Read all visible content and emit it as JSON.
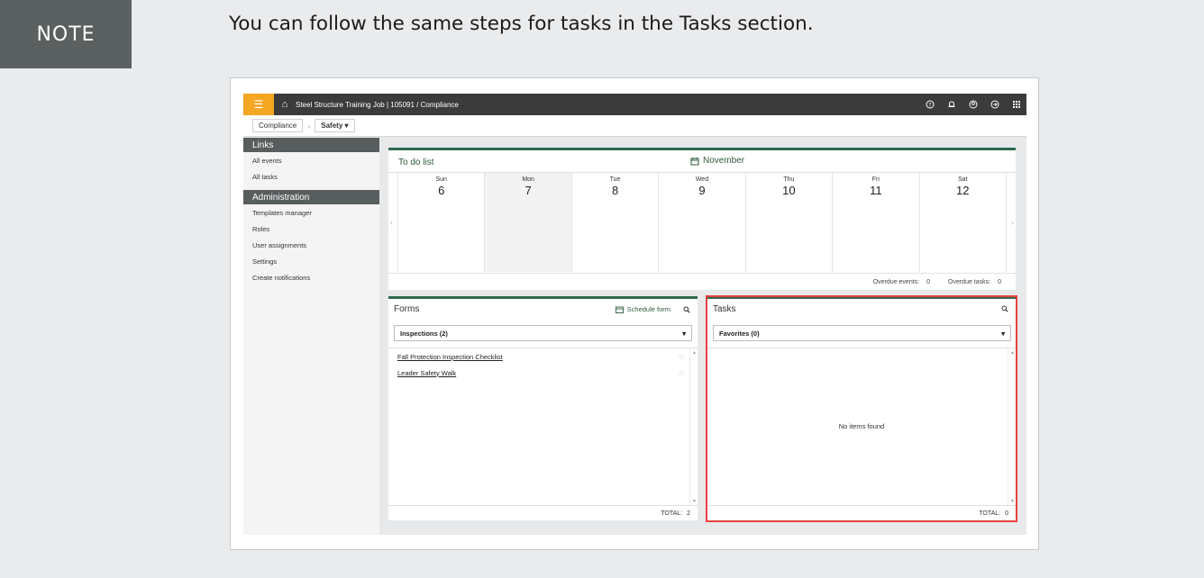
{
  "note": {
    "badge": "NOTE",
    "text": "You can follow the same steps for tasks in the Tasks section."
  },
  "topbar": {
    "menu_glyph": "☰",
    "home_glyph": "⌂",
    "title": "Steel Structure Training Job | 105091  /  Compliance",
    "icons": [
      "help-icon",
      "bell-icon",
      "user-icon",
      "logout-icon",
      "apps-grid-icon"
    ]
  },
  "breadcrumb": {
    "parent": "Compliance",
    "current": "Safety",
    "caret": "▾"
  },
  "sidebar": {
    "links_header": "Links",
    "links": [
      "All events",
      "All tasks"
    ],
    "admin_header": "Administration",
    "admin_items": [
      "Templates manager",
      "Roles",
      "User assignments",
      "Settings",
      "Create notifications"
    ]
  },
  "todo": {
    "title": "To do list",
    "month": "November",
    "days": [
      {
        "name": "Sun",
        "num": "6"
      },
      {
        "name": "Mon",
        "num": "7"
      },
      {
        "name": "Tue",
        "num": "8"
      },
      {
        "name": "Wed",
        "num": "9"
      },
      {
        "name": "Thu",
        "num": "10"
      },
      {
        "name": "Fri",
        "num": "11"
      },
      {
        "name": "Sat",
        "num": "12"
      }
    ],
    "overdue_events_label": "Overdue events:",
    "overdue_events_value": "0",
    "overdue_tasks_label": "Overdue tasks:",
    "overdue_tasks_value": "0"
  },
  "forms": {
    "title": "Forms",
    "schedule_label": "Schedule form",
    "select_value": "Inspections (2)",
    "items": [
      "Fall Protection Inspection Checklist",
      "Leader Safety Walk"
    ],
    "total_label": "TOTAL:",
    "total_value": "2"
  },
  "tasks": {
    "title": "Tasks",
    "select_value": "Favorites (0)",
    "empty_message": "No items found",
    "total_label": "TOTAL:",
    "total_value": "0"
  },
  "colors": {
    "accent_orange": "#f5a623",
    "header_dark": "#3b3b3b",
    "brand_green": "#2d6a4f",
    "highlight_red": "#e8413f"
  }
}
